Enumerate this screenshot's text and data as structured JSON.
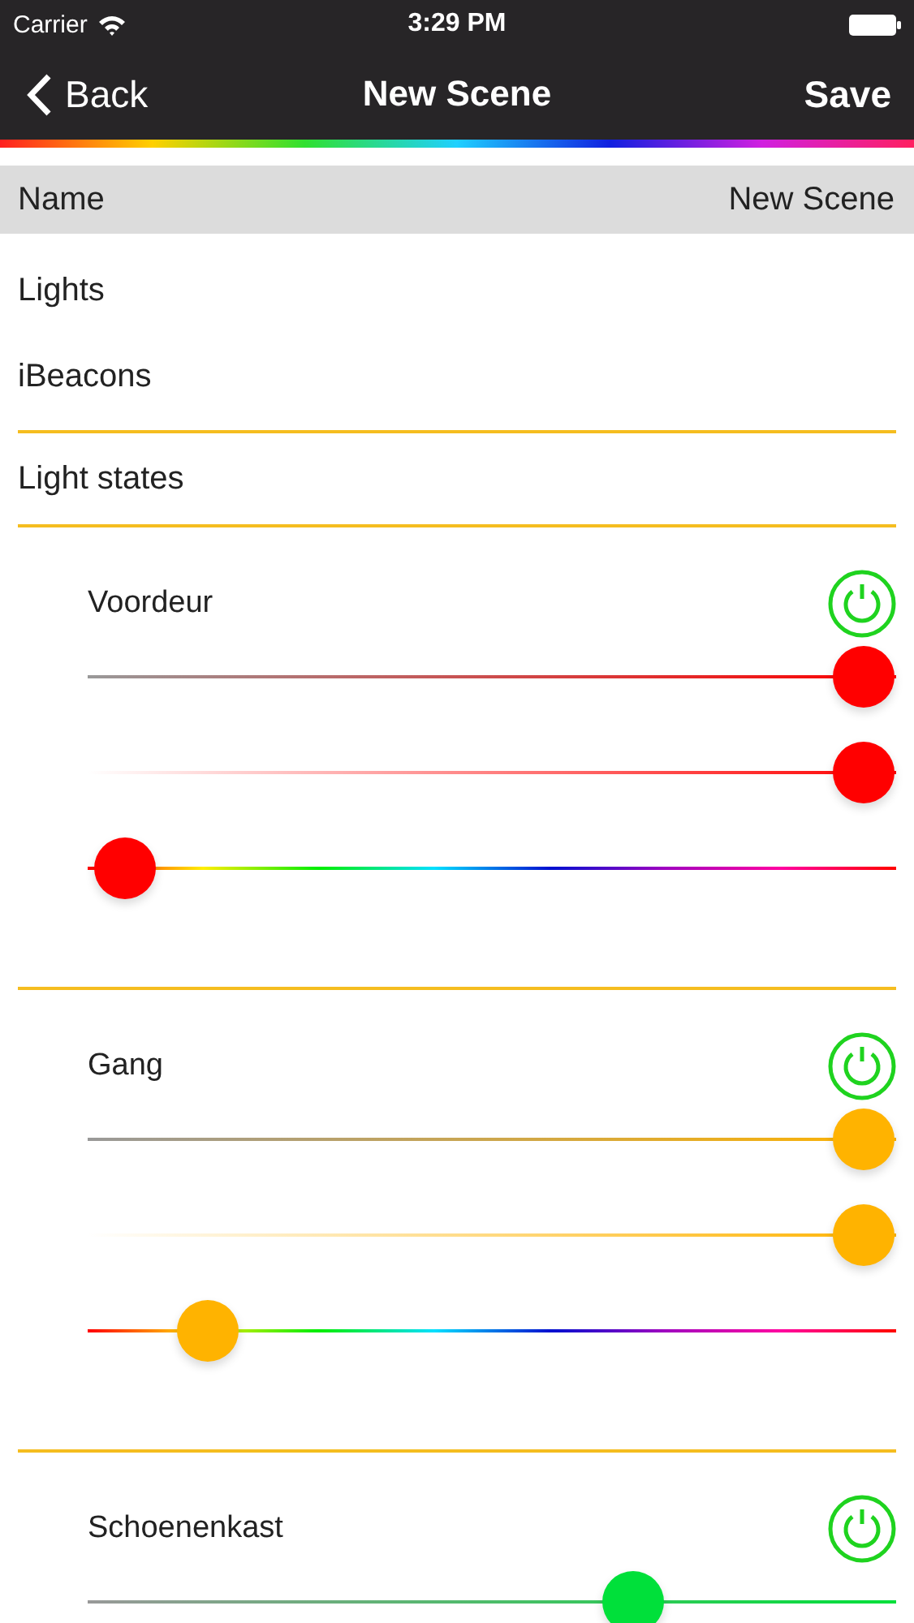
{
  "status_bar": {
    "carrier": "Carrier",
    "time": "3:29 PM"
  },
  "nav": {
    "back": "Back",
    "title": "New Scene",
    "action": "Save"
  },
  "name_row": {
    "label": "Name",
    "value": "New Scene"
  },
  "menu_rows": [
    "Lights",
    "iBeacons"
  ],
  "section": "Light states",
  "lights": [
    {
      "name": "Voordeur",
      "on": true,
      "color": "#ff0000",
      "sliders": [
        {
          "kind": "brightness",
          "level": 0.96
        },
        {
          "kind": "saturation",
          "level": 0.96
        },
        {
          "kind": "hue",
          "level": 0.046
        }
      ]
    },
    {
      "name": "Gang",
      "on": true,
      "color": "#ffb300",
      "sliders": [
        {
          "kind": "brightness",
          "level": 0.96
        },
        {
          "kind": "saturation",
          "level": 0.96
        },
        {
          "kind": "hue",
          "level": 0.148
        }
      ]
    },
    {
      "name": "Schoenenkast",
      "on": true,
      "color": "#00e03a",
      "sliders": [
        {
          "kind": "brightness",
          "level": 0.675
        }
      ]
    }
  ]
}
